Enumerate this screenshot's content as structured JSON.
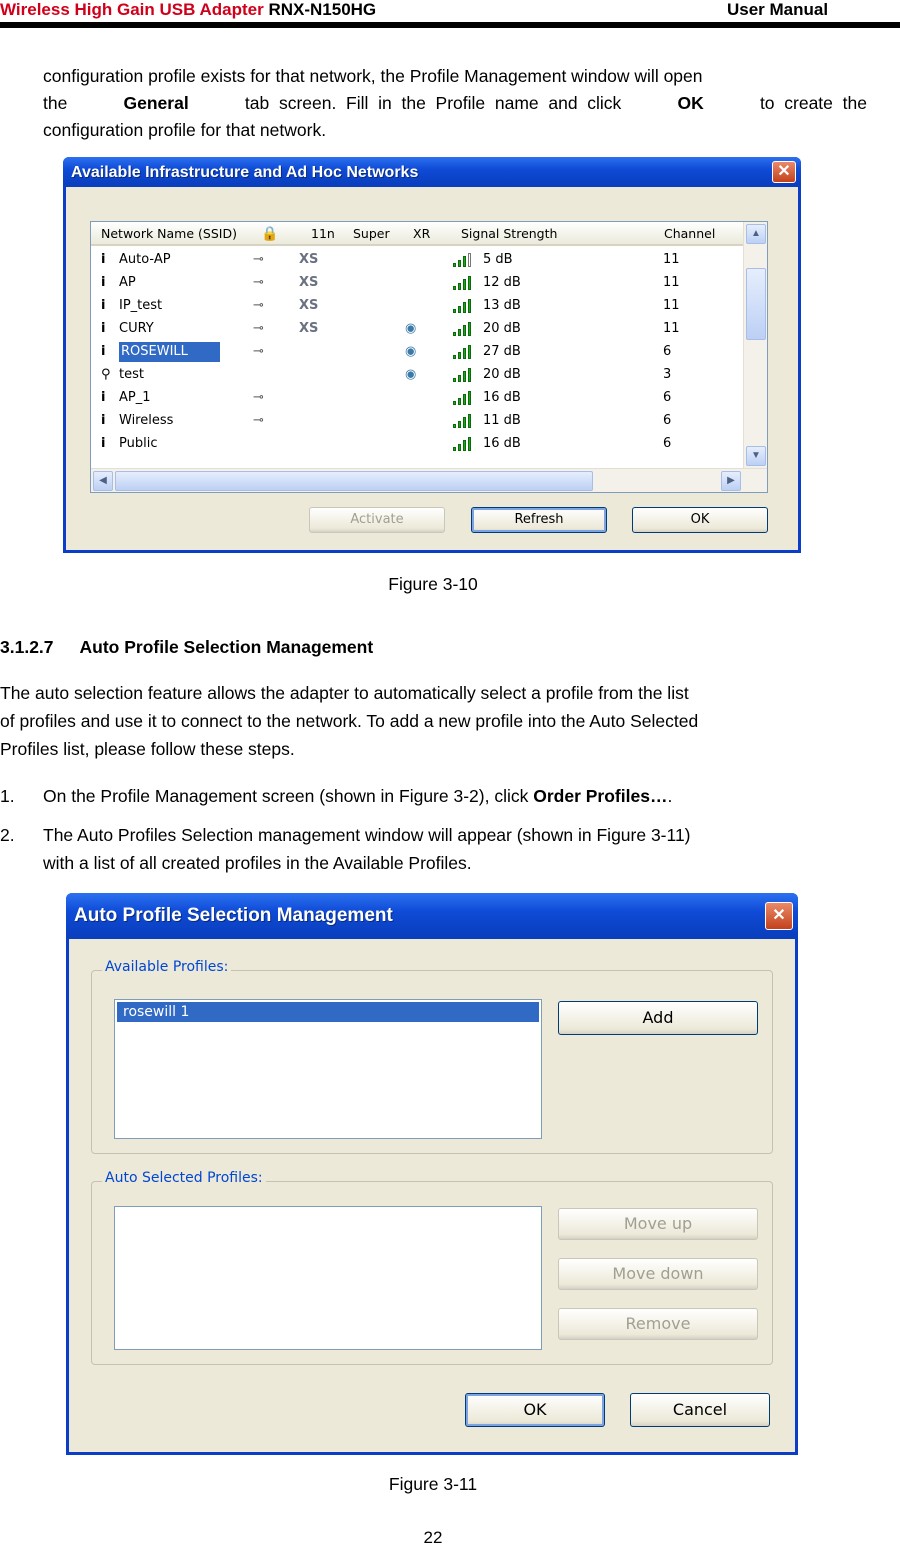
{
  "header": {
    "product_red": "Wireless High Gain USB Adapter",
    "product_model": "RNX-N150HG",
    "manual": "User Manual"
  },
  "intro": {
    "p1": "configuration profile exists for that network, the Profile Management window will open",
    "p2_pre": "the",
    "p2_b1": "General",
    "p2_mid": "tab  screen.  Fill  in  the  Profile  name  and  click",
    "p2_b2": "OK",
    "p2_post": "to  create  the",
    "p3": "configuration profile for that network."
  },
  "fig10": {
    "window_title": "Available Infrastructure and Ad Hoc Networks",
    "columns": [
      "Network Name (SSID)",
      "11n",
      "Super",
      "XR",
      "Signal Strength",
      "Channel"
    ],
    "rows": [
      {
        "ssid": "Auto-AP",
        "lock": true,
        "xs": "XS",
        "xr": false,
        "signal": "5 dB",
        "channel": "11",
        "bars": 3
      },
      {
        "ssid": "AP",
        "lock": true,
        "xs": "XS",
        "xr": false,
        "signal": "12 dB",
        "channel": "11",
        "bars": 4
      },
      {
        "ssid": "IP_test",
        "lock": true,
        "xs": "XS",
        "xr": false,
        "signal": "13 dB",
        "channel": "11",
        "bars": 4
      },
      {
        "ssid": "CURY",
        "lock": true,
        "xs": "XS",
        "xr": true,
        "signal": "20 dB",
        "channel": "11",
        "bars": 4
      },
      {
        "ssid": "ROSEWILL",
        "lock": true,
        "xs": "",
        "xr": true,
        "signal": "27 dB",
        "channel": "6",
        "bars": 4,
        "selected": true
      },
      {
        "ssid": "test",
        "lock": false,
        "xs": "",
        "xr": true,
        "signal": "20 dB",
        "channel": "3",
        "bars": 4,
        "adhoc": true
      },
      {
        "ssid": "AP_1",
        "lock": true,
        "xs": "",
        "xr": false,
        "signal": "16 dB",
        "channel": "6",
        "bars": 4
      },
      {
        "ssid": "Wireless",
        "lock": true,
        "xs": "",
        "xr": false,
        "signal": "11 dB",
        "channel": "6",
        "bars": 4
      },
      {
        "ssid": "Public",
        "lock": false,
        "xs": "",
        "xr": false,
        "signal": "16 dB",
        "channel": "6",
        "bars": 4
      }
    ],
    "buttons": {
      "activate": "Activate",
      "refresh": "Refresh",
      "ok": "OK"
    },
    "caption": "Figure 3-10"
  },
  "section": {
    "number": "3.1.2.7",
    "title": "Auto Profile Selection Management",
    "body1": "The auto selection feature allows the adapter to automatically select a profile from the list",
    "body2": "of profiles and use it to connect to the network. To add a new profile into the Auto Selected",
    "body3": "Profiles list, please follow these steps.",
    "step1_num": "1.",
    "step1_pre": "On the Profile Management screen (shown in Figure 3-2), click",
    "step1_bold": "Order Profiles…",
    "step1_post": ".",
    "step2_num": "2.",
    "step2_l1": "The Auto Profiles Selection management window will appear (shown in Figure 3-11)",
    "step2_l2": "with a list of all created profiles in the Available Profiles."
  },
  "fig11": {
    "window_title": "Auto Profile Selection Management",
    "available_label": "Available Profiles:",
    "available_items": [
      "rosewill 1"
    ],
    "add": "Add",
    "auto_label": "Auto Selected Profiles:",
    "move_up": "Move up",
    "move_down": "Move down",
    "remove": "Remove",
    "ok": "OK",
    "cancel": "Cancel",
    "caption": "Figure 3-11"
  },
  "page_number": "22"
}
